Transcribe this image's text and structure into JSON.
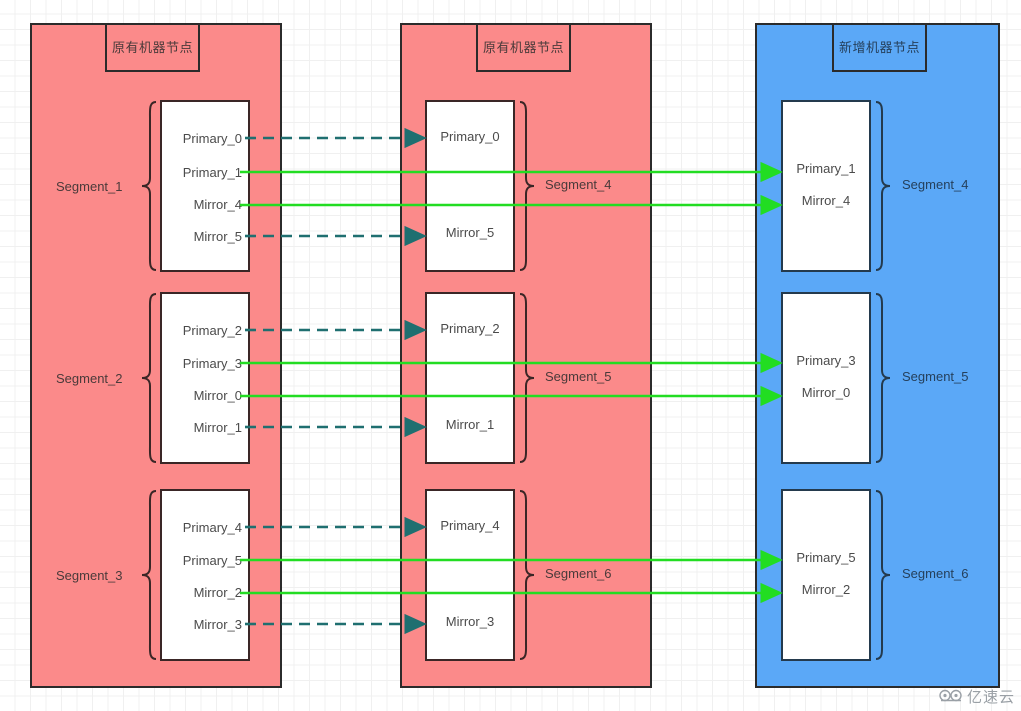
{
  "columns": [
    {
      "id": "col-old-1",
      "kind": "existing",
      "header": "原有机器节点",
      "fill": "#fb8a8a",
      "segments": [
        {
          "name": "Segment_1",
          "name_side": "left",
          "entries": [
            "Primary_0",
            "Primary_1",
            "Mirror_4",
            "Mirror_5"
          ]
        },
        {
          "name": "Segment_2",
          "name_side": "left",
          "entries": [
            "Primary_2",
            "Primary_3",
            "Mirror_0",
            "Mirror_1"
          ]
        },
        {
          "name": "Segment_3",
          "name_side": "left",
          "entries": [
            "Primary_4",
            "Primary_5",
            "Mirror_2",
            "Mirror_3"
          ]
        }
      ]
    },
    {
      "id": "col-old-2",
      "kind": "existing",
      "header": "原有机器节点",
      "fill": "#fb8a8a",
      "segments": [
        {
          "name": "Segment_4",
          "name_side": "right",
          "entries": [
            "Primary_0",
            "Mirror_5"
          ]
        },
        {
          "name": "Segment_5",
          "name_side": "right",
          "entries": [
            "Primary_2",
            "Mirror_1"
          ]
        },
        {
          "name": "Segment_6",
          "name_side": "right",
          "entries": [
            "Primary_4",
            "Mirror_3"
          ]
        }
      ]
    },
    {
      "id": "col-new",
      "kind": "new",
      "header": "新增机器节点",
      "fill": "#5ba8f7",
      "segments": [
        {
          "name": "Segment_4",
          "name_side": "right",
          "entries": [
            "Primary_1",
            "Mirror_4"
          ]
        },
        {
          "name": "Segment_5",
          "name_side": "right",
          "entries": [
            "Primary_3",
            "Mirror_0"
          ]
        },
        {
          "name": "Segment_6",
          "name_side": "right",
          "entries": [
            "Primary_5",
            "Mirror_2"
          ]
        }
      ]
    }
  ],
  "connections": {
    "dashed_color": "#1f6f70",
    "solid_color": "#22dd22",
    "dashed": [
      {
        "from": "Primary_0",
        "to": "Primary_0"
      },
      {
        "from": "Mirror_5",
        "to": "Mirror_5"
      },
      {
        "from": "Primary_2",
        "to": "Primary_2"
      },
      {
        "from": "Mirror_1",
        "to": "Mirror_1"
      },
      {
        "from": "Primary_4",
        "to": "Primary_4"
      },
      {
        "from": "Mirror_3",
        "to": "Mirror_3"
      }
    ],
    "solid": [
      {
        "from": "Primary_1",
        "to": "Primary_1"
      },
      {
        "from": "Mirror_4",
        "to": "Mirror_4"
      },
      {
        "from": "Primary_3",
        "to": "Primary_3"
      },
      {
        "from": "Mirror_0",
        "to": "Mirror_0"
      },
      {
        "from": "Primary_5",
        "to": "Primary_5"
      },
      {
        "from": "Mirror_2",
        "to": "Mirror_2"
      }
    ]
  },
  "watermark": {
    "text": "亿速云"
  },
  "labels": {
    "col1": {
      "s1": {
        "name": "Segment_1",
        "e0": "Primary_0",
        "e1": "Primary_1",
        "e2": "Mirror_4",
        "e3": "Mirror_5"
      },
      "s2": {
        "name": "Segment_2",
        "e0": "Primary_2",
        "e1": "Primary_3",
        "e2": "Mirror_0",
        "e3": "Mirror_1"
      },
      "s3": {
        "name": "Segment_3",
        "e0": "Primary_4",
        "e1": "Primary_5",
        "e2": "Mirror_2",
        "e3": "Mirror_3"
      }
    },
    "col2": {
      "header": "原有机器节点",
      "s4": {
        "name": "Segment_4",
        "e0": "Primary_0",
        "e1": "Mirror_5"
      },
      "s5": {
        "name": "Segment_5",
        "e0": "Primary_2",
        "e1": "Mirror_1"
      },
      "s6": {
        "name": "Segment_6",
        "e0": "Primary_4",
        "e1": "Mirror_3"
      }
    },
    "col3": {
      "header": "新增机器节点",
      "s4": {
        "name": "Segment_4",
        "e0": "Primary_1",
        "e1": "Mirror_4"
      },
      "s5": {
        "name": "Segment_5",
        "e0": "Primary_3",
        "e1": "Mirror_0"
      },
      "s6": {
        "name": "Segment_6",
        "e0": "Primary_5",
        "e1": "Mirror_2"
      }
    },
    "col1_header": "原有机器节点"
  }
}
